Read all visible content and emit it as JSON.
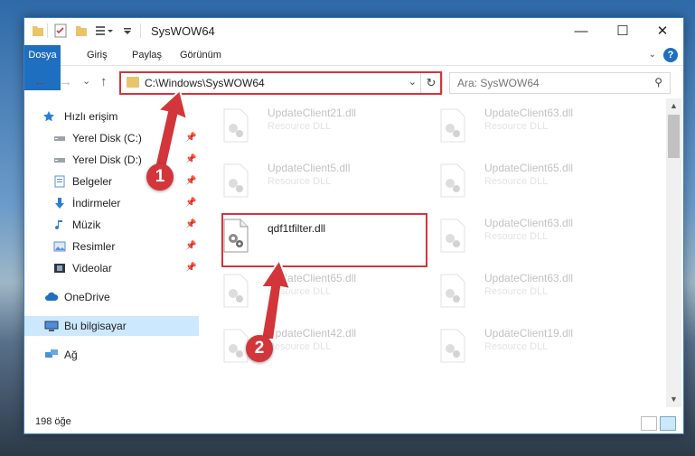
{
  "window": {
    "title": "SysWOW64",
    "controls": {
      "minimize": "—",
      "maximize": "☐",
      "close": "✕"
    }
  },
  "ribbon": {
    "tabs": [
      "Dosya",
      "Giriş",
      "Paylaş",
      "Görünüm"
    ],
    "help_label": "?"
  },
  "nav": {
    "back": "←",
    "forward": "→",
    "recent": "⌄",
    "up": "↑",
    "address": "C:\\Windows\\SysWOW64",
    "search_placeholder": "Ara: SysWOW64"
  },
  "sidebar": {
    "items": [
      {
        "label": "Hızlı erişim",
        "icon": "star-icon",
        "pinned": false
      },
      {
        "label": "Yerel Disk (C:)",
        "icon": "drive-icon",
        "pinned": true
      },
      {
        "label": "Yerel Disk (D:)",
        "icon": "drive-icon",
        "pinned": true
      },
      {
        "label": "Belgeler",
        "icon": "documents-icon",
        "pinned": true
      },
      {
        "label": "İndirmeler",
        "icon": "download-icon",
        "pinned": true
      },
      {
        "label": "Müzik",
        "icon": "music-icon",
        "pinned": true
      },
      {
        "label": "Resimler",
        "icon": "pictures-icon",
        "pinned": true
      },
      {
        "label": "Videolar",
        "icon": "video-icon",
        "pinned": true
      },
      {
        "label": "OneDrive",
        "icon": "cloud-icon",
        "pinned": false
      },
      {
        "label": "Bu bilgisayar",
        "icon": "computer-icon",
        "pinned": false
      },
      {
        "label": "Ağ",
        "icon": "network-icon",
        "pinned": false
      }
    ]
  },
  "files": [
    {
      "name": "UpdateClient21.dll",
      "type": "Resource DLL"
    },
    {
      "name": "UpdateClient63.dll",
      "type": "Resource DLL"
    },
    {
      "name": "UpdateClient5.dll",
      "type": "Resource DLL"
    },
    {
      "name": "UpdateClient65.dll",
      "type": "Resource DLL"
    },
    {
      "name": "qdf1tfilter.dll",
      "type": ""
    },
    {
      "name": "UpdateClient63.dll",
      "type": "Resource DLL"
    },
    {
      "name": "UpdateClient65.dll",
      "type": "Resource DLL"
    },
    {
      "name": "UpdateClient63.dll",
      "type": "Resource DLL"
    },
    {
      "name": "UpdateClient42.dll",
      "type": "Resource DLL"
    },
    {
      "name": "UpdateClient19.dll",
      "type": "Resource DLL"
    }
  ],
  "status": {
    "item_count": "198 öğe"
  },
  "callouts": {
    "one": "1",
    "two": "2"
  },
  "colors": {
    "accent": "#1f6fc0",
    "highlight": "#d2363a",
    "selection": "#cce8ff"
  }
}
